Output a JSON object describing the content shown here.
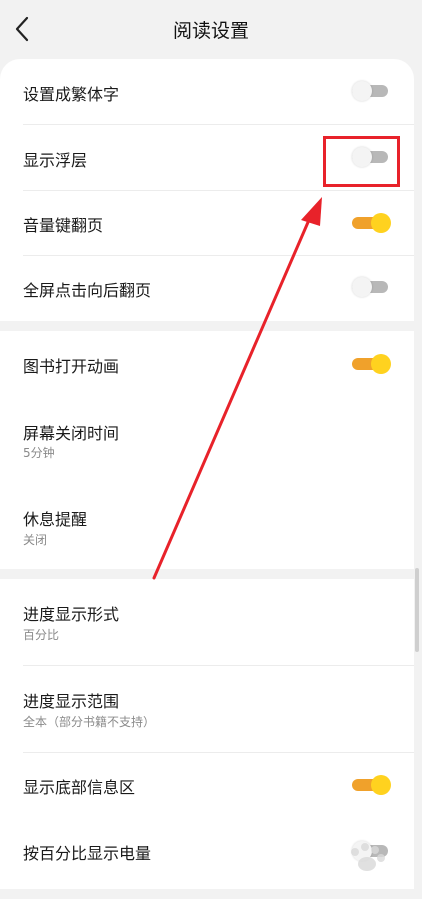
{
  "header": {
    "title": "阅读设置"
  },
  "section1": {
    "rows": [
      {
        "label": "设置成繁体字",
        "toggle": "off"
      },
      {
        "label": "显示浮层",
        "toggle": "off"
      },
      {
        "label": "音量键翻页",
        "toggle": "on"
      },
      {
        "label": "全屏点击向后翻页",
        "toggle": "off"
      }
    ]
  },
  "section2": {
    "rows": [
      {
        "label": "图书打开动画",
        "toggle": "on"
      },
      {
        "label": "屏幕关闭时间",
        "value": "5分钟"
      },
      {
        "label": "休息提醒",
        "value": "关闭"
      }
    ]
  },
  "section3": {
    "rows": [
      {
        "label": "进度显示形式",
        "value": "百分比"
      },
      {
        "label": "进度显示范围",
        "value": "全本（部分书籍不支持）"
      },
      {
        "label": "显示底部信息区",
        "toggle": "on"
      },
      {
        "label": "按百分比显示电量",
        "toggle": "off"
      }
    ]
  },
  "colors": {
    "toggle_on_track": "#f0a12b",
    "toggle_on_knob": "#ffd21f",
    "annotation_red": "#e8222a"
  },
  "icons": {
    "back": "chevron-left-icon"
  }
}
